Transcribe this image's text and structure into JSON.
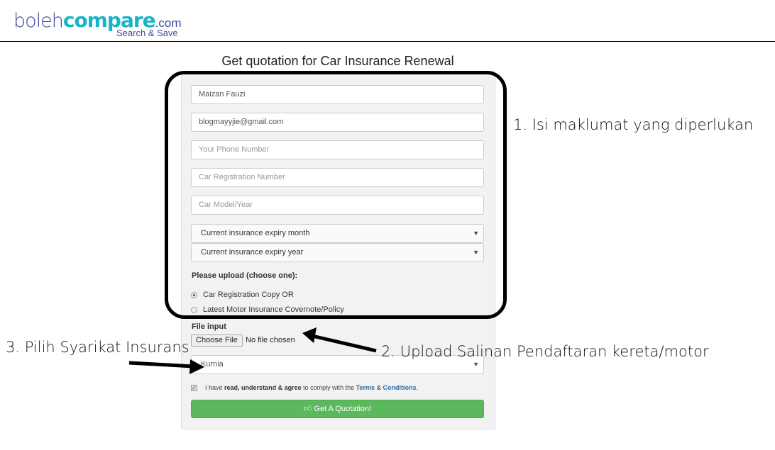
{
  "header": {
    "logo_part1": "boleh",
    "logo_part2": "compare",
    "logo_part3": ".com",
    "logo_tagline": "Search & Save"
  },
  "form": {
    "title": "Get quotation for Car Insurance Renewal",
    "name_value": "Maizan Fauzi",
    "email_value": "blogmayyjie@gmail.com",
    "phone_placeholder": "Your Phone Number",
    "reg_placeholder": "Car Registration Number",
    "model_placeholder": "Car Model/Year",
    "expiry_month": "Current insurance expiry month",
    "expiry_year": "Current insurance expiry year",
    "upload_label": "Please upload (choose one):",
    "radio_options": [
      {
        "label": "Car Registration Copy OR",
        "selected": true
      },
      {
        "label": "Latest Motor Insurance Covernote/Policy",
        "selected": false
      }
    ],
    "file_label": "File input",
    "choose_file": "Choose File",
    "no_file": "No file chosen",
    "insurer": "Kurnia",
    "agree_pre": "I have ",
    "agree_bold": "read, understand & agree",
    "agree_mid": " to comply with the ",
    "agree_link": "Terms & Conditions",
    "agree_end": ".",
    "agree_checked": true,
    "submit": "Get A Quotation!",
    "submit_icon": "thumbs-up-icon",
    "submit_color": "#5cb85c"
  },
  "annotations": {
    "a1": "1. Isi maklumat yang diperlukan",
    "a2": "2. Upload Salinan Pendaftaran kereta/motor",
    "a3": "3. Pilih Syarikat Insurans"
  }
}
